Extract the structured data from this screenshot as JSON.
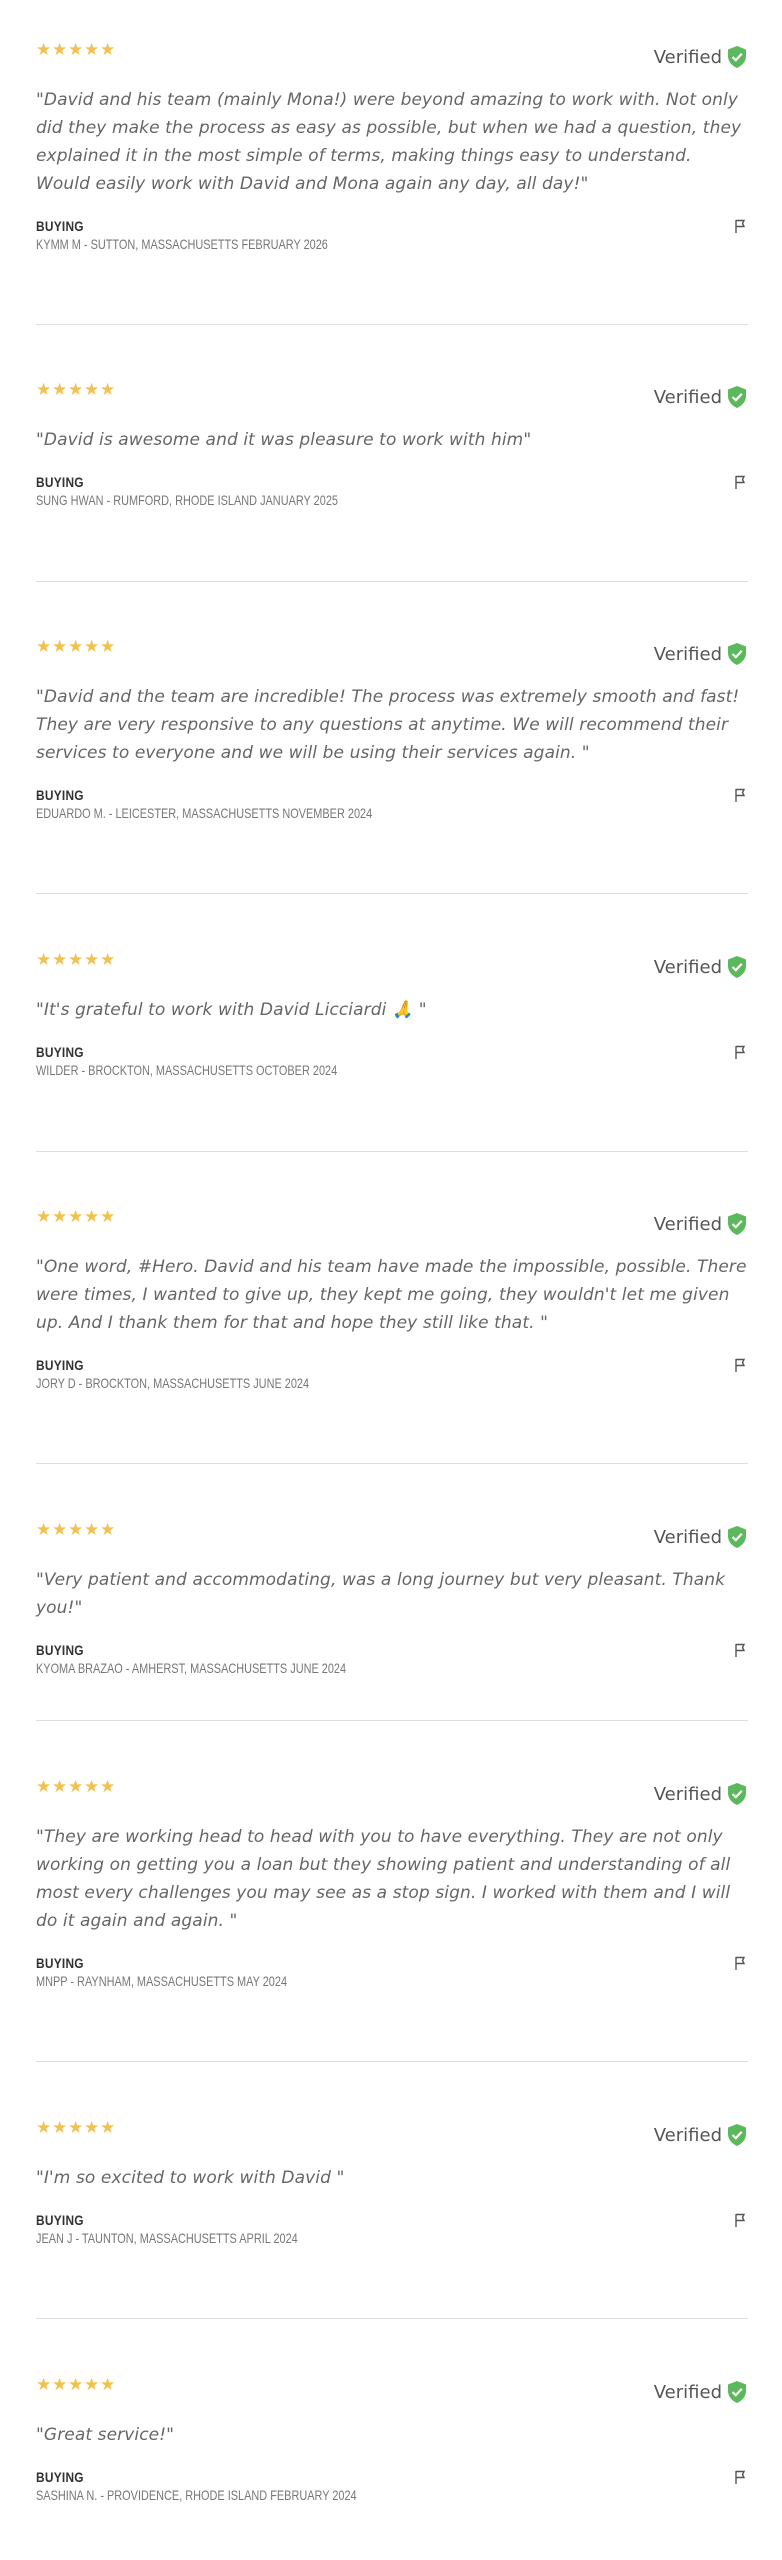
{
  "reviews": [
    {
      "rating": 5,
      "verified_label": "Verified",
      "quote": "\"David and his team (mainly Mona!) were beyond amazing to work with. Not only did they make the process as easy as possible, but when we had a question, they explained it in the most simple of terms, making things easy to understand. Would easily work with David and Mona again any day, all day!\"",
      "type": "BUYING",
      "reviewer": "KYMM M - SUTTON, MASSACHUSETTS FEBRUARY 2026"
    },
    {
      "rating": 5,
      "verified_label": "Verified",
      "quote": "\"David is awesome and it was pleasure to work with him\"",
      "type": "BUYING",
      "reviewer": "SUNG HWAN - RUMFORD, RHODE ISLAND JANUARY 2025"
    },
    {
      "rating": 5,
      "verified_label": "Verified",
      "quote": "\"David and the team are incredible! The process was extremely smooth and fast! They are very responsive to any questions at anytime. We will recommend their services to everyone and we will be using their services again. \"",
      "type": "BUYING",
      "reviewer": "EDUARDO M. - LEICESTER, MASSACHUSETTS NOVEMBER 2024"
    },
    {
      "rating": 5,
      "verified_label": "Verified",
      "quote": "\"It's grateful to work with David Licciardi 🙏 \"",
      "type": "BUYING",
      "reviewer": "WILDER - BROCKTON, MASSACHUSETTS OCTOBER 2024"
    },
    {
      "rating": 5,
      "verified_label": "Verified",
      "quote": "\"One word, #Hero. David and his team have made the impossible, possible. There were times, I wanted to give up, they kept me going, they wouldn't let me given up. And I thank them for that and hope they still like that. \"",
      "type": "BUYING",
      "reviewer": "JORY D - BROCKTON, MASSACHUSETTS JUNE 2024"
    },
    {
      "rating": 5,
      "verified_label": "Verified",
      "quote": "\"Very patient and accommodating, was a long journey but very pleasant. Thank you!\"",
      "type": "BUYING",
      "reviewer": "KYOMA BRAZAO - AMHERST, MASSACHUSETTS JUNE 2024"
    },
    {
      "rating": 5,
      "verified_label": "Verified",
      "quote": "\"They are working head to head with you to have everything. They are not only working on getting you a loan but they showing patient and understanding of all most every challenges you may see as a stop sign. I worked with them and I will do it again and again. \"",
      "type": "BUYING",
      "reviewer": "MNPP - RAYNHAM, MASSACHUSETTS MAY 2024"
    },
    {
      "rating": 5,
      "verified_label": "Verified",
      "quote": "\"I'm so excited to work with David \"",
      "type": "BUYING",
      "reviewer": "JEAN J - TAUNTON, MASSACHUSETTS APRIL 2024"
    },
    {
      "rating": 5,
      "verified_label": "Verified",
      "quote": "\"Great service!\"",
      "type": "BUYING",
      "reviewer": "SASHINA N. - PROVIDENCE, RHODE ISLAND FEBRUARY 2024"
    }
  ],
  "colors": {
    "star": "#f2c14e",
    "shield": "#5cb85c",
    "divider": "#dddddd"
  },
  "icons": {
    "star": "star-icon",
    "verified": "shield-check-icon",
    "report": "flag-icon"
  }
}
